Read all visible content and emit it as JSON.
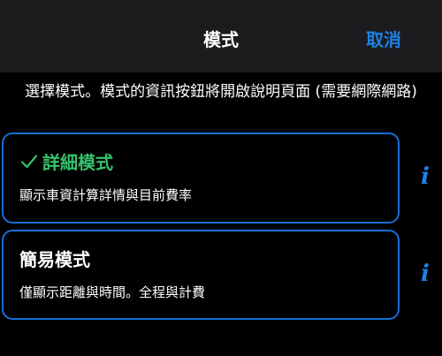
{
  "header": {
    "title": "模式",
    "cancel_label": "取消"
  },
  "instructions": "選擇模式。模式的資訊按鈕將開啟說明頁面 (需要網際網路)",
  "modes": [
    {
      "title": "詳細模式",
      "description": "顯示車資計算詳情與目前費率",
      "selected": true,
      "icon": "checkmark-icon"
    },
    {
      "title": "簡易模式",
      "description": "僅顯示距離與時間。全程與計費",
      "selected": false
    }
  ],
  "info_glyph": "i",
  "colors": {
    "accent": "#1a82e8",
    "card_border": "#1a6fd6",
    "selected_text": "#35c26a",
    "header_bg": "#1c1c1e",
    "background": "#000000"
  }
}
